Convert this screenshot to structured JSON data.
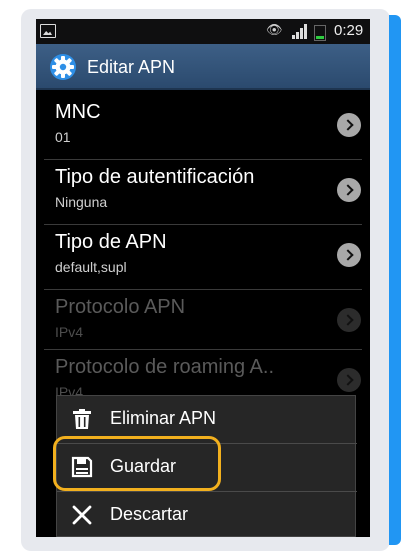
{
  "status_bar": {
    "time": "0:29"
  },
  "action_bar": {
    "title": "Editar APN",
    "icon": "settings-gear-icon"
  },
  "settings": [
    {
      "title": "MNC",
      "value": "01",
      "enabled": true
    },
    {
      "title": "Tipo de autentificación",
      "value": "Ninguna",
      "enabled": true
    },
    {
      "title": "Tipo de APN",
      "value": "default,supl",
      "enabled": true
    },
    {
      "title": "Protocolo APN",
      "value": "IPv4",
      "enabled": false
    },
    {
      "title": "Protocolo de roaming A..",
      "value": "IPv4",
      "enabled": false
    }
  ],
  "menu": {
    "items": [
      {
        "label": "Eliminar APN",
        "icon": "trash-icon"
      },
      {
        "label": "Guardar",
        "icon": "save-icon",
        "highlighted": true
      },
      {
        "label": "Descartar",
        "icon": "close-icon"
      }
    ]
  },
  "colors": {
    "action_bar": "#2b4a6e",
    "highlight": "#f2b01e",
    "side_accent": "#2196f3"
  }
}
